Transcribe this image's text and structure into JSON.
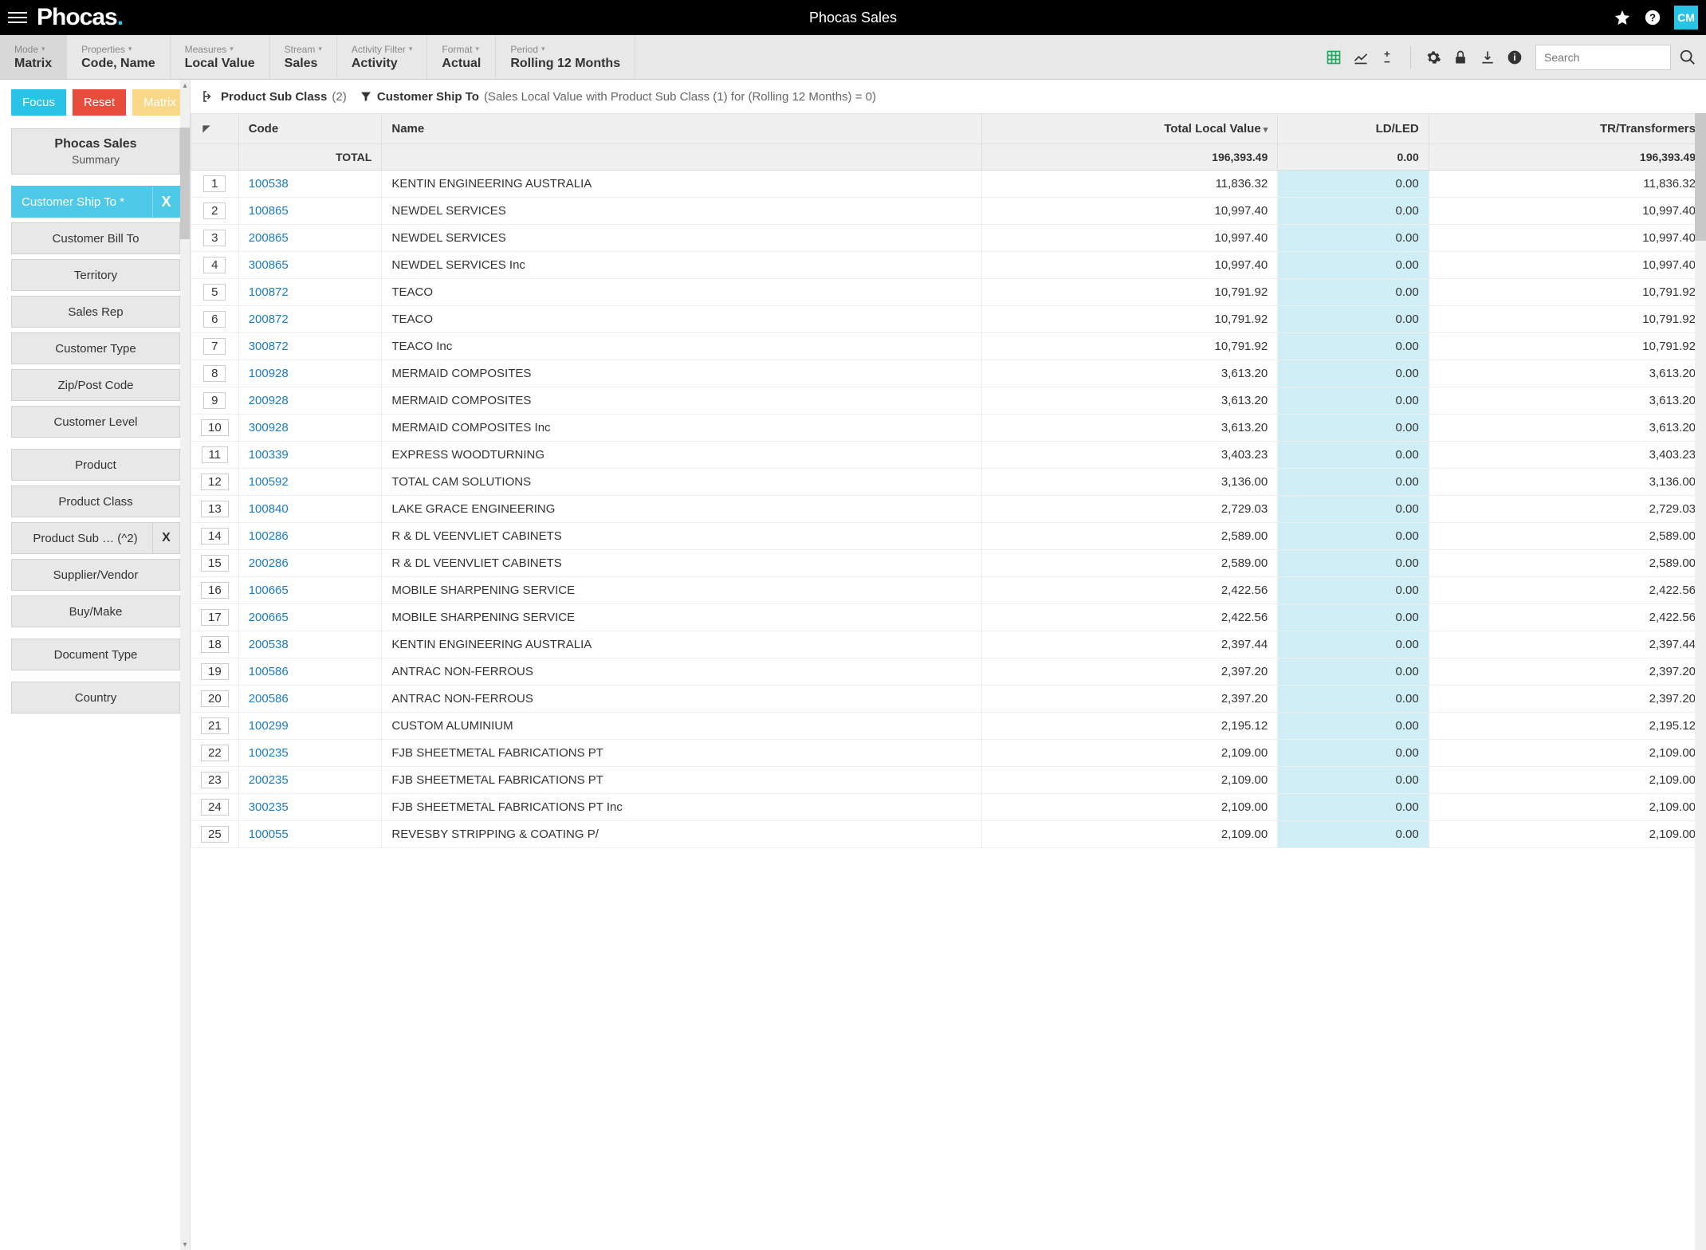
{
  "header": {
    "title": "Phocas Sales",
    "logo_text": "Phocas",
    "user_initials": "CM"
  },
  "ribbon": {
    "items": [
      {
        "label": "Mode",
        "value": "Matrix",
        "cls": "mode"
      },
      {
        "label": "Properties",
        "value": "Code, Name"
      },
      {
        "label": "Measures",
        "value": "Local Value"
      },
      {
        "label": "Stream",
        "value": "Sales"
      },
      {
        "label": "Activity Filter",
        "value": "Activity"
      },
      {
        "label": "Format",
        "value": "Actual"
      },
      {
        "label": "Period",
        "value": "Rolling 12 Months"
      }
    ],
    "search_placeholder": "Search"
  },
  "action_buttons": {
    "focus": "Focus",
    "reset": "Reset",
    "matrix": "Matrix"
  },
  "breadcrumb": {
    "item1_label": "Product Sub Class",
    "item1_count": "(2)",
    "item2_label": "Customer Ship To",
    "item2_desc": "(Sales Local Value with Product Sub Class (1) for (Rolling 12 Months) = 0)"
  },
  "sidebar": {
    "card": {
      "title": "Phocas Sales",
      "subtitle": "Summary"
    },
    "group1": [
      {
        "label": "Customer Ship To *",
        "active": true,
        "x": true
      },
      {
        "label": "Customer Bill To"
      },
      {
        "label": "Territory"
      },
      {
        "label": "Sales Rep"
      },
      {
        "label": "Customer Type"
      },
      {
        "label": "Zip/Post Code"
      },
      {
        "label": "Customer Level"
      }
    ],
    "group2": [
      {
        "label": "Product"
      },
      {
        "label": "Product Class"
      },
      {
        "label": "Product Sub … (^2)",
        "x": true
      },
      {
        "label": "Supplier/Vendor"
      },
      {
        "label": "Buy/Make"
      }
    ],
    "group3": [
      {
        "label": "Document Type"
      }
    ],
    "group4": [
      {
        "label": "Country"
      }
    ]
  },
  "table": {
    "columns": {
      "code": "Code",
      "name": "Name",
      "total": "Total Local Value",
      "ldled": "LD/LED",
      "trtrans": "TR/Transformers"
    },
    "total_label": "TOTAL",
    "totals": {
      "total": "196,393.49",
      "ldled": "0.00",
      "trtrans": "196,393.49"
    },
    "rows": [
      {
        "idx": "1",
        "code": "100538",
        "name": "KENTIN ENGINEERING AUSTRALIA",
        "total": "11,836.32",
        "ldled": "0.00",
        "trtrans": "11,836.32"
      },
      {
        "idx": "2",
        "code": "100865",
        "name": "NEWDEL SERVICES",
        "total": "10,997.40",
        "ldled": "0.00",
        "trtrans": "10,997.40"
      },
      {
        "idx": "3",
        "code": "200865",
        "name": "NEWDEL SERVICES",
        "total": "10,997.40",
        "ldled": "0.00",
        "trtrans": "10,997.40"
      },
      {
        "idx": "4",
        "code": "300865",
        "name": "NEWDEL SERVICES Inc",
        "total": "10,997.40",
        "ldled": "0.00",
        "trtrans": "10,997.40"
      },
      {
        "idx": "5",
        "code": "100872",
        "name": "TEACO",
        "total": "10,791.92",
        "ldled": "0.00",
        "trtrans": "10,791.92"
      },
      {
        "idx": "6",
        "code": "200872",
        "name": "TEACO",
        "total": "10,791.92",
        "ldled": "0.00",
        "trtrans": "10,791.92"
      },
      {
        "idx": "7",
        "code": "300872",
        "name": "TEACO Inc",
        "total": "10,791.92",
        "ldled": "0.00",
        "trtrans": "10,791.92"
      },
      {
        "idx": "8",
        "code": "100928",
        "name": "MERMAID COMPOSITES",
        "total": "3,613.20",
        "ldled": "0.00",
        "trtrans": "3,613.20"
      },
      {
        "idx": "9",
        "code": "200928",
        "name": "MERMAID COMPOSITES",
        "total": "3,613.20",
        "ldled": "0.00",
        "trtrans": "3,613.20"
      },
      {
        "idx": "10",
        "code": "300928",
        "name": "MERMAID COMPOSITES Inc",
        "total": "3,613.20",
        "ldled": "0.00",
        "trtrans": "3,613.20"
      },
      {
        "idx": "11",
        "code": "100339",
        "name": "EXPRESS WOODTURNING",
        "total": "3,403.23",
        "ldled": "0.00",
        "trtrans": "3,403.23"
      },
      {
        "idx": "12",
        "code": "100592",
        "name": "TOTAL CAM SOLUTIONS",
        "total": "3,136.00",
        "ldled": "0.00",
        "trtrans": "3,136.00"
      },
      {
        "idx": "13",
        "code": "100840",
        "name": "LAKE GRACE ENGINEERING",
        "total": "2,729.03",
        "ldled": "0.00",
        "trtrans": "2,729.03"
      },
      {
        "idx": "14",
        "code": "100286",
        "name": "R & DL VEENVLIET CABINETS",
        "total": "2,589.00",
        "ldled": "0.00",
        "trtrans": "2,589.00"
      },
      {
        "idx": "15",
        "code": "200286",
        "name": "R & DL VEENVLIET CABINETS",
        "total": "2,589.00",
        "ldled": "0.00",
        "trtrans": "2,589.00"
      },
      {
        "idx": "16",
        "code": "100665",
        "name": "MOBILE SHARPENING SERVICE",
        "total": "2,422.56",
        "ldled": "0.00",
        "trtrans": "2,422.56"
      },
      {
        "idx": "17",
        "code": "200665",
        "name": "MOBILE SHARPENING SERVICE",
        "total": "2,422.56",
        "ldled": "0.00",
        "trtrans": "2,422.56"
      },
      {
        "idx": "18",
        "code": "200538",
        "name": "KENTIN ENGINEERING AUSTRALIA",
        "total": "2,397.44",
        "ldled": "0.00",
        "trtrans": "2,397.44"
      },
      {
        "idx": "19",
        "code": "100586",
        "name": "ANTRAC NON-FERROUS",
        "total": "2,397.20",
        "ldled": "0.00",
        "trtrans": "2,397.20"
      },
      {
        "idx": "20",
        "code": "200586",
        "name": "ANTRAC NON-FERROUS",
        "total": "2,397.20",
        "ldled": "0.00",
        "trtrans": "2,397.20"
      },
      {
        "idx": "21",
        "code": "100299",
        "name": "CUSTOM ALUMINIUM",
        "total": "2,195.12",
        "ldled": "0.00",
        "trtrans": "2,195.12"
      },
      {
        "idx": "22",
        "code": "100235",
        "name": "FJB SHEETMETAL FABRICATIONS PT",
        "total": "2,109.00",
        "ldled": "0.00",
        "trtrans": "2,109.00"
      },
      {
        "idx": "23",
        "code": "200235",
        "name": "FJB SHEETMETAL FABRICATIONS PT",
        "total": "2,109.00",
        "ldled": "0.00",
        "trtrans": "2,109.00"
      },
      {
        "idx": "24",
        "code": "300235",
        "name": "FJB SHEETMETAL FABRICATIONS PT Inc",
        "total": "2,109.00",
        "ldled": "0.00",
        "trtrans": "2,109.00"
      },
      {
        "idx": "25",
        "code": "100055",
        "name": "REVESBY STRIPPING & COATING P/",
        "total": "2,109.00",
        "ldled": "0.00",
        "trtrans": "2,109.00"
      }
    ]
  }
}
